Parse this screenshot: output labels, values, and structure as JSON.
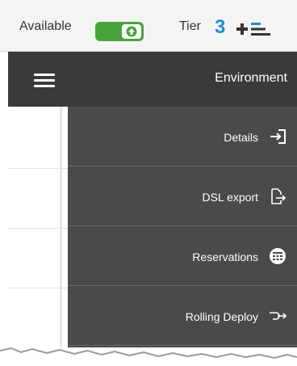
{
  "status": {
    "availability_label": "Available",
    "tier_label": "Tier",
    "tier_value": "3"
  },
  "header": {
    "title": "Environment"
  },
  "menu": {
    "items": [
      {
        "label": "Details",
        "icon": "sign-in-arrow-icon"
      },
      {
        "label": "DSL export",
        "icon": "export-file-icon"
      },
      {
        "label": "Reservations",
        "icon": "calendar-grid-icon"
      },
      {
        "label": "Rolling Deploy",
        "icon": "rolling-arrow-icon"
      }
    ]
  },
  "colors": {
    "toggle_on": "#48a43a",
    "tier_accent": "#1b8fd8",
    "header_bg": "#3a3a3a",
    "menu_bg": "#4a4a4a"
  }
}
